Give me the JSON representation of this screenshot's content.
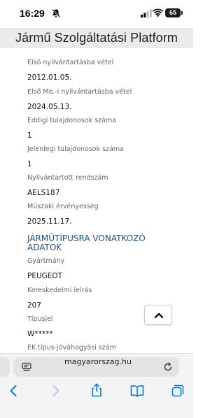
{
  "status_bar": {
    "time": "16:29",
    "battery": "65"
  },
  "header": {
    "title": "Jármű Szolgáltatási Platform"
  },
  "fields": [
    {
      "label": "Első nyilvántartásba vétel",
      "value": "2012.01.05."
    },
    {
      "label": "Első Mo.-i nyilvántartásba vétel",
      "value": "2024.05.13."
    },
    {
      "label": "Eddigi tulajdonosok száma",
      "value": "1"
    },
    {
      "label": "Jelenlegi tulajdonosok száma",
      "value": "1"
    },
    {
      "label": "Nyilvántartott rendszám",
      "value": "AELS187"
    },
    {
      "label": "Műszaki érvényesség",
      "value": "2025.11.17."
    }
  ],
  "section": {
    "title": "JÁRMŰTÍPUSRA VONATKOZÓ ADATOK"
  },
  "type_fields": [
    {
      "label": "Gyártmány",
      "value": "PEUGEOT"
    },
    {
      "label": "Kereskedelmi leírás",
      "value": "207"
    },
    {
      "label": "Típusjel",
      "value": "W*****"
    },
    {
      "label": "EK típus-jóváhagyási szám",
      "value": ""
    }
  ],
  "browser": {
    "url": "magyarorszag.hu"
  },
  "colors": {
    "accent": "#1f4e8c",
    "ios_blue": "#007aff"
  },
  "icons": [
    "bell-off-icon",
    "signal-icon",
    "wifi-icon",
    "battery-icon",
    "chevron-up-icon",
    "page-menu-icon",
    "reload-icon",
    "back-icon",
    "forward-icon",
    "share-icon",
    "bookmarks-icon",
    "tabs-icon"
  ]
}
